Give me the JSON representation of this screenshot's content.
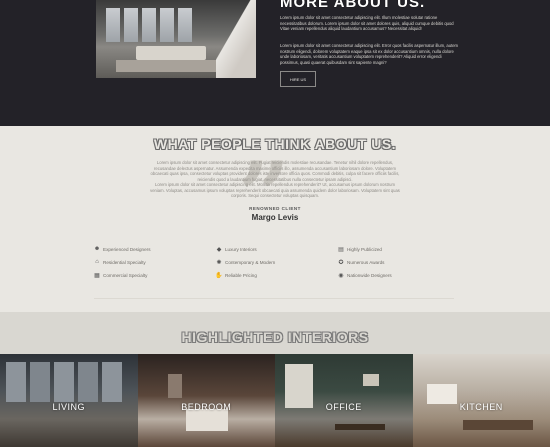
{
  "about": {
    "title": "MORE ABOUT US.",
    "p1": "Lorem ipsum dolor sit amet consectetur adipiscing elit. Illum molestiae soluta! ratione necessitatibus dolorum. Lorem ipsum dolor sit amet dolores quis, aliquid cumque debitis quod Vitae veniam repellendus aliquid laudantium accusamus? Necessitat aliquid!",
    "p2": "Lorem ipsum dolor sit amet consectetur adipiscing elit. Error quos facilis aspernatur illum, autem nostrum eligendi, dolorem voluptatem eaque ipsa sit ex dolor accusantium omnis, nulla dolore unde laboriosam, veritatis accusantium voluptatem reprehenderit? Aliquid error eligendi possimus, quasi quaerat quibusdam sint sapiente magni?",
    "button_label": "HIRE US"
  },
  "testimonial": {
    "title": "WHAT PEOPLE THINK ABOUT US.",
    "p1": "Lorem ipsum dolor sit amet consectetur adipiscing elit. Fugiat reiciendis molestiae recusandae. Tenetur nihil dolore repellendus, recusandae delectus aspernatur. Assumenda expedita maxime officiis illo, assumenda accusantium laboriosam dolore. Voluptatem obcaecati quas ipsa, consectetur voluptas provident dolores iste inventore officia quos. Commodi debitis, culpa sit facere officiis facilis, reiciendis quod a laudantium fugiat, necessitatibus nulla consectetur ipsam adipisci.",
    "p2": "Lorem ipsum dolor sit amet consectetur adipiscing elit. Mollitia repellendus reprehenderit? Ut, accusamus ipsum dolorum nostrum veniam. Voluptas, accusamus ipsum voluptas reprehenderit obcaecati quia assumenda quidem dolor laboriosam. Voluptatem sint quas corporis. Sequi consectetur voluptas quisquam.",
    "client_role": "RENOWNED CLIENT",
    "client_name": "Margo Levis"
  },
  "features": [
    {
      "label": "Experienced Designers",
      "icon": "group-icon"
    },
    {
      "label": "Luxury Interiors",
      "icon": "diamond-icon"
    },
    {
      "label": "Highly Publicized",
      "icon": "newspaper-icon"
    },
    {
      "label": "Residential Specialty",
      "icon": "house-icon"
    },
    {
      "label": "Contemporary & Modern",
      "icon": "gear-icon"
    },
    {
      "label": "Numerous Awards",
      "icon": "award-icon"
    },
    {
      "label": "Commercial Specialty",
      "icon": "building-icon"
    },
    {
      "label": "Reliable Pricing",
      "icon": "handshake-icon"
    },
    {
      "label": "Nationwide Designers",
      "icon": "globe-icon"
    }
  ],
  "highlight": {
    "title": "HIGHLIGHTED INTERIORS"
  },
  "rooms": [
    "LIVING",
    "BEDROOM",
    "OFFICE",
    "KITCHEN"
  ]
}
